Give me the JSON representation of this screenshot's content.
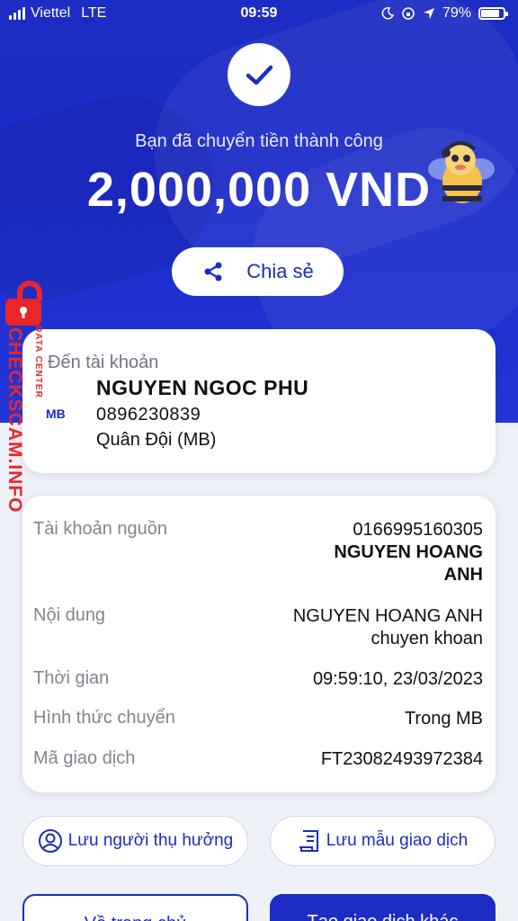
{
  "status_bar": {
    "carrier": "Viettel",
    "network": "LTE",
    "time": "09:59",
    "battery": "79%"
  },
  "header": {
    "success_message": "Bạn đã chuyển tiền thành công",
    "amount": "2,000,000 VND",
    "share_label": "Chia sẻ"
  },
  "watermark": {
    "text": "CHECKSCAM.INFO",
    "sub": "DATA CENTER"
  },
  "destination": {
    "label": "Đến tài khoản",
    "bank_logo": "MB",
    "name": "NGUYEN NGOC PHU",
    "account_number": "0896230839",
    "bank": "Quân Đội (MB)"
  },
  "details": {
    "source_label": "Tài khoản nguồn",
    "source_account": "0166995160305",
    "source_name_line1": "NGUYEN HOANG",
    "source_name_line2": "ANH",
    "content_label": "Nội dung",
    "content_line1": "NGUYEN HOANG ANH",
    "content_line2": "chuyen khoan",
    "time_label": "Thời gian",
    "time_value": "09:59:10, 23/03/2023",
    "method_label": "Hình thức chuyển",
    "method_value": "Trong MB",
    "code_label": "Mã giao dịch",
    "code_value": "FT23082493972384"
  },
  "actions": {
    "save_beneficiary": "Lưu người thụ hưởng",
    "save_template": "Lưu mẫu giao dịch",
    "home": "Về trang chủ",
    "new_transaction": "Tạo giao dịch khác"
  },
  "colors": {
    "primary": "#1d2cc4",
    "watermark": "#e8262b"
  }
}
